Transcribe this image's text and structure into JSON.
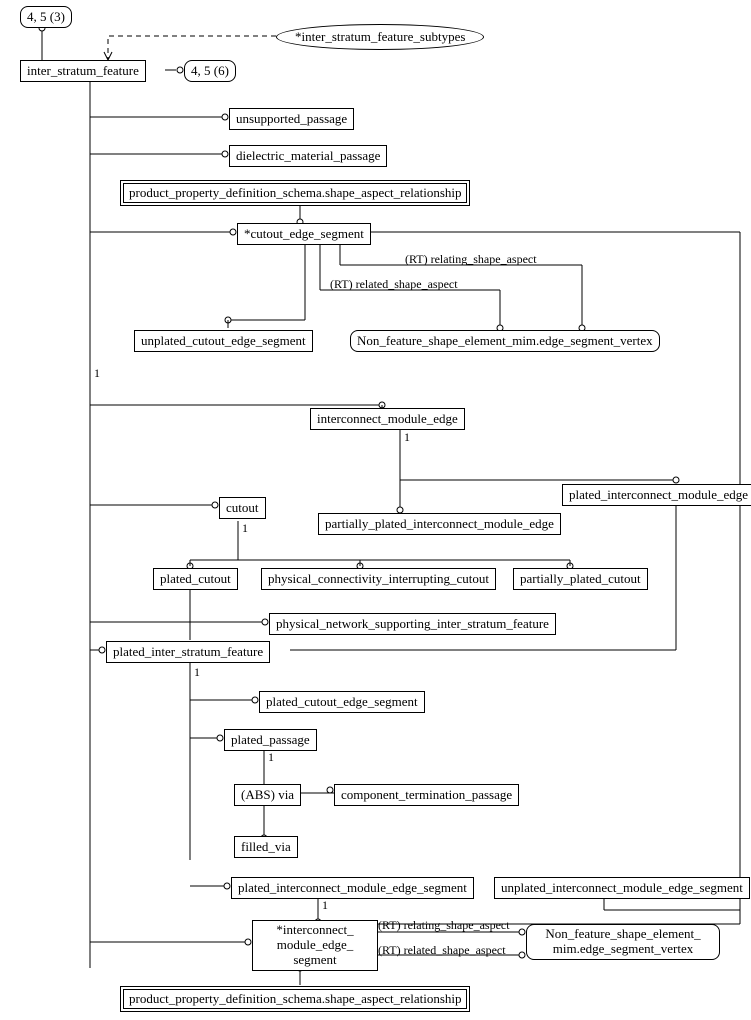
{
  "refs": {
    "top": "4, 5 (3)",
    "side": "4, 5 (6)"
  },
  "nodes": {
    "inter_stratum_feature_subtypes": "*inter_stratum_feature_subtypes",
    "inter_stratum_feature": "inter_stratum_feature",
    "unsupported_passage": "unsupported_passage",
    "dielectric_material_passage": "dielectric_material_passage",
    "ppds_sar_top": "product_property_definition_schema.shape_aspect_relationship",
    "cutout_edge_segment": "*cutout_edge_segment",
    "unplated_cutout_edge_segment": "unplated_cutout_edge_segment",
    "nfse_top": "Non_feature_shape_element_mim.edge_segment_vertex",
    "interconnect_module_edge": "interconnect_module_edge",
    "plated_interconnect_module_edge": "plated_interconnect_module_edge",
    "partially_plated_interconnect_module_edge": "partially_plated_interconnect_module_edge",
    "cutout": "cutout",
    "plated_cutout": "plated_cutout",
    "physical_connectivity_interrupting_cutout": "physical_connectivity_interrupting_cutout",
    "partially_plated_cutout": "partially_plated_cutout",
    "physical_network_supporting_isf": "physical_network_supporting_inter_stratum_feature",
    "plated_inter_stratum_feature": "plated_inter_stratum_feature",
    "plated_cutout_edge_segment": "plated_cutout_edge_segment",
    "plated_passage": "plated_passage",
    "abs_via": "(ABS) via",
    "component_termination_passage": "component_termination_passage",
    "filled_via": "filled_via",
    "plated_interconnect_module_edge_segment": "plated_interconnect_module_edge_segment",
    "unplated_interconnect_module_edge_segment": "unplated_interconnect_module_edge_segment",
    "interconnect_module_edge_segment": "*interconnect_\nmodule_edge_\nsegment",
    "nfse_bottom": "Non_feature_shape_element_\nmim.edge_segment_vertex",
    "ppds_sar_bottom": "product_property_definition_schema.shape_aspect_relationship"
  },
  "edge_labels": {
    "rt_relating_top": "(RT) relating_shape_aspect",
    "rt_related_top": "(RT) related_shape_aspect",
    "rt_relating_bottom": "(RT) relating_shape_aspect",
    "rt_related_bottom": "(RT) related_shape_aspect",
    "one_a": "1",
    "one_b": "1",
    "one_c": "1",
    "one_d": "1",
    "one_e": "1",
    "one_f": "1"
  }
}
